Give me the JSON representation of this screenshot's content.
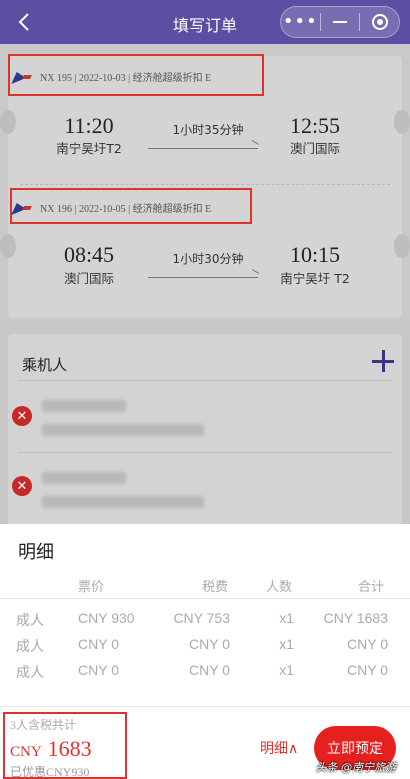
{
  "header": {
    "title": "填写订单"
  },
  "flights": [
    {
      "tag": "NX 195 | 2022-10-03 | 经济舱超级折扣 E",
      "dep_time": "11:20",
      "dep_city": "南宁吴圩T2",
      "duration": "1小时35分钟",
      "arr_time": "12:55",
      "arr_city": "澳门国际"
    },
    {
      "tag": "NX 196 | 2022-10-05 | 经济舱超级折扣 E",
      "dep_time": "08:45",
      "dep_city": "澳门国际",
      "duration": "1小时30分钟",
      "arr_time": "10:15",
      "arr_city": "南宁吴圩 T2"
    }
  ],
  "passengers": {
    "title": "乘机人"
  },
  "detail": {
    "title": "明细",
    "headers": [
      "票价",
      "税费",
      "人数",
      "合计"
    ],
    "rows": [
      {
        "type": "成人",
        "fare": "CNY 930",
        "tax": "CNY 753",
        "count": "x1",
        "total": "CNY 1683"
      },
      {
        "type": "成人",
        "fare": "CNY 0",
        "tax": "CNY 0",
        "count": "x1",
        "total": "CNY 0"
      },
      {
        "type": "成人",
        "fare": "CNY 0",
        "tax": "CNY 0",
        "count": "x1",
        "total": "CNY 0"
      }
    ]
  },
  "footer": {
    "total_label": "3人含税共计",
    "currency": "CNY",
    "amount": "1683",
    "discount": "已优惠CNY930",
    "detail_link": "明细∧",
    "book_button": "立即预定",
    "watermark": "头条 @南宁旅游"
  },
  "colors": {
    "header": "#5a4fa2",
    "accent": "#e0322d",
    "button": "#e61f1f"
  }
}
